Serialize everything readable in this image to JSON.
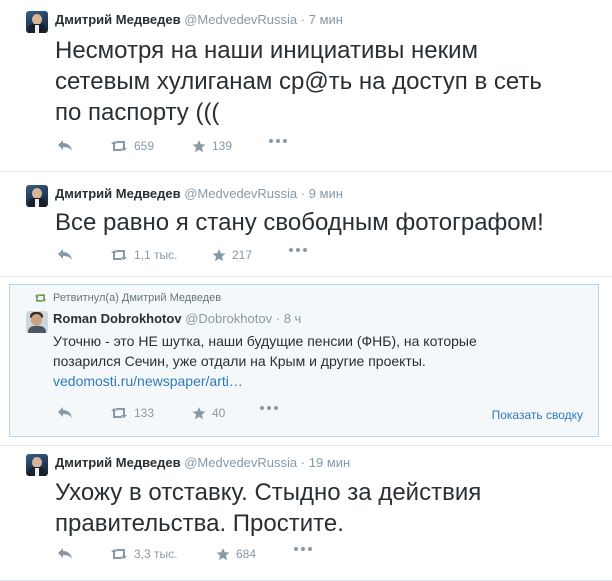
{
  "colors": {
    "accent": "#2b7bb9",
    "muted": "#8899a6",
    "text": "#292f33",
    "highlight_bg": "#f5f8fa",
    "highlight_border": "#b8d6ec",
    "retweet_green": "#5c913b"
  },
  "tweets": [
    {
      "name": "Дмитрий Медведев",
      "handle": "@MedvedevRussia",
      "dot": "·",
      "time": "7 мин",
      "text_lines": [
        "Несмотря на наши инициативы неким",
        "сетевым хулиганам ср@ть на доступ в сеть",
        "по паспорту  ((("
      ],
      "retweets": "659",
      "favorites": "139"
    },
    {
      "name": "Дмитрий Медведев",
      "handle": "@MedvedevRussia",
      "dot": "·",
      "time": "9 мин",
      "text_lines": [
        "Все равно я стану свободным фотографом!"
      ],
      "retweets": "1,1 тыс.",
      "favorites": "217"
    },
    {
      "retweeted_by": "Ретвитнул(а) Дмитрий Медведев",
      "name": "Roman Dobrokhotov",
      "handle": "@Dobrokhotov",
      "dot": "·",
      "time": "8 ч",
      "text_lines": [
        "Уточню - это НЕ шутка, наши будущие пенсии (ФНБ), на которые",
        "позарился Сечин, уже отдали на Крым и другие проекты."
      ],
      "link": "vedomosti.ru/newspaper/arti…",
      "retweets": "133",
      "favorites": "40",
      "summary": "Показать сводку"
    },
    {
      "name": "Дмитрий Медведев",
      "handle": "@MedvedevRussia",
      "dot": "·",
      "time": "19 мин",
      "text_lines": [
        "Ухожу в отставку. Стыдно за действия",
        "правительства. Простите."
      ],
      "retweets": "3,3 тыс.",
      "favorites": "684"
    }
  ],
  "icons": {
    "reply": "reply-icon",
    "retweet": "retweet-icon",
    "favorite": "star-icon",
    "more": "more-icon"
  }
}
